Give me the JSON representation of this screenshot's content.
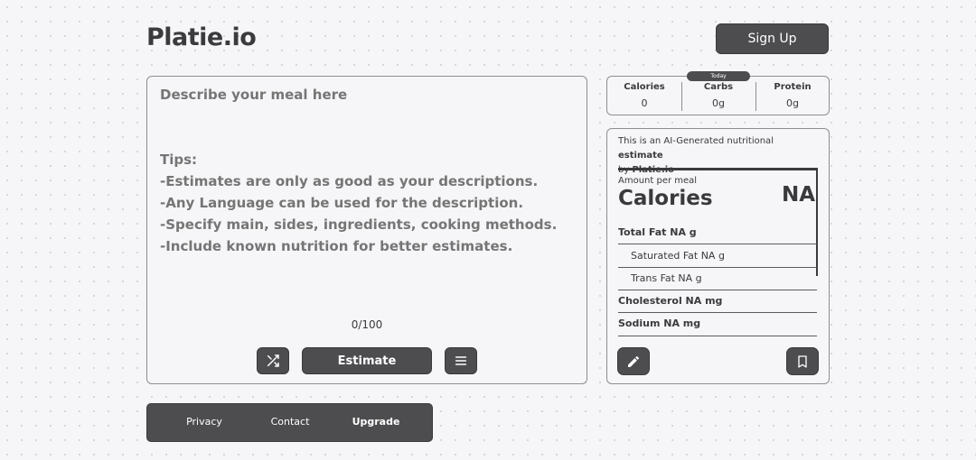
{
  "header": {
    "logo": "Platie.io",
    "signup_label": "Sign Up"
  },
  "meal": {
    "placeholder": "Describe your meal here\n\n\nTips:\n-Estimates are only as good as your descriptions.\n-Any Language can be used for the description.\n-Specify main, sides, ingredients, cooking methods.\n-Include known nutrition for better estimates.",
    "char_count": "0/100",
    "estimate_label": "Estimate"
  },
  "footer": {
    "privacy": "Privacy",
    "contact": "Contact",
    "upgrade": "Upgrade"
  },
  "today": {
    "badge": "Today",
    "calories_label": "Calories",
    "calories_value": "0",
    "carbs_label": "Carbs",
    "carbs_value": "0g",
    "protein_label": "Protein",
    "protein_value": "0g"
  },
  "nutrition": {
    "intro_prefix": "This is an AI-Generated nutritional ",
    "intro_estimate": "estimate",
    "intro_by": "by ",
    "intro_brand": "Platie.io",
    "amount_label": "Amount per meal",
    "calories_title": "Calories",
    "calories_value": "NA",
    "total_fat": "Total Fat NA g",
    "saturated_fat": "Saturated Fat NA g",
    "trans_fat": "Trans Fat NA g",
    "cholesterol": "Cholesterol NA mg",
    "sodium": "Sodium NA mg"
  },
  "icons": {
    "shuffle": "shuffle-icon",
    "menu": "menu-icon",
    "edit": "pencil-icon",
    "bookmark": "bookmark-icon"
  },
  "colors": {
    "button": "#4d4d4f",
    "background": "#f6f6f8",
    "text": "#3a3a3c",
    "placeholder": "#8c8c8f"
  }
}
